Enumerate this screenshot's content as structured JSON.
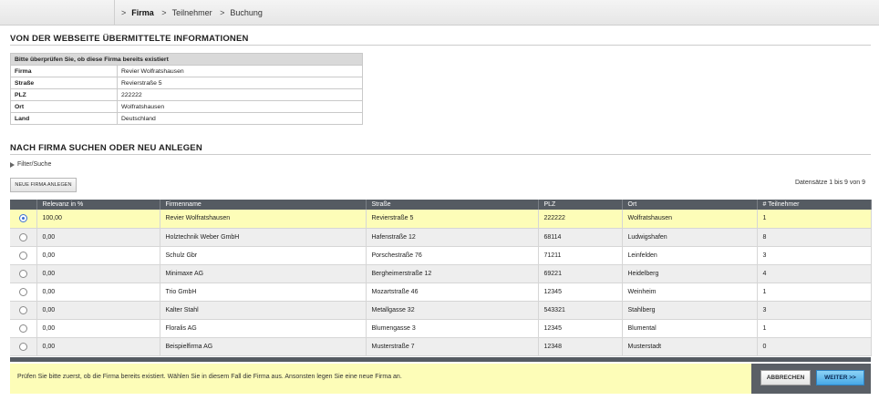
{
  "breadcrumb": {
    "items": [
      {
        "sep": ">",
        "label": "Firma"
      },
      {
        "sep": ">",
        "label": "Teilnehmer"
      },
      {
        "sep": ">",
        "label": "Buchung"
      }
    ]
  },
  "section1": {
    "title": "VON DER WEBSEITE ÜBERMITTELTE INFORMATIONEN",
    "table_header": "Bitte überprüfen Sie, ob diese Firma bereits existiert",
    "rows": [
      {
        "label": "Firma",
        "value": "Revier Wolfratshausen"
      },
      {
        "label": "Straße",
        "value": "Revierstraße 5"
      },
      {
        "label": "PLZ",
        "value": "222222"
      },
      {
        "label": "Ort",
        "value": "Wolfratshausen"
      },
      {
        "label": "Land",
        "value": "Deutschland"
      }
    ]
  },
  "section2": {
    "title": "NACH FIRMA SUCHEN ODER NEU ANLEGEN",
    "filter_label": "Filter/Suche",
    "new_button": "NEUE FIRMA ANLEGEN",
    "records_info": "Datensätze 1 bis 9 von 9"
  },
  "grid": {
    "columns": [
      "",
      "Relevanz in %",
      "Firmenname",
      "Straße",
      "PLZ",
      "Ort",
      "# Teilnehmer"
    ],
    "rows": [
      {
        "selected": true,
        "relevance": "100,00",
        "name": "Revier Wolfratshausen",
        "street": "Revierstraße 5",
        "plz": "222222",
        "city": "Wolfratshausen",
        "participants": "1"
      },
      {
        "selected": false,
        "relevance": "0,00",
        "name": "Holztechnik Weber GmbH",
        "street": "Hafenstraße 12",
        "plz": "68114",
        "city": "Ludwigshafen",
        "participants": "8"
      },
      {
        "selected": false,
        "relevance": "0,00",
        "name": "Schulz Gbr",
        "street": "Porschestraße 76",
        "plz": "71211",
        "city": "Leinfelden",
        "participants": "3"
      },
      {
        "selected": false,
        "relevance": "0,00",
        "name": "Minimaxe AG",
        "street": "Bergheimerstraße 12",
        "plz": "69221",
        "city": "Heidelberg",
        "participants": "4"
      },
      {
        "selected": false,
        "relevance": "0,00",
        "name": "Trio GmbH",
        "street": "Mozartstraße 46",
        "plz": "12345",
        "city": "Weinheim",
        "participants": "1"
      },
      {
        "selected": false,
        "relevance": "0,00",
        "name": "Kalter Stahl",
        "street": "Metallgasse 32",
        "plz": "543321",
        "city": "Stahlberg",
        "participants": "3"
      },
      {
        "selected": false,
        "relevance": "0,00",
        "name": "Floralis AG",
        "street": "Blumengasse 3",
        "plz": "12345",
        "city": "Blumental",
        "participants": "1"
      },
      {
        "selected": false,
        "relevance": "0,00",
        "name": "Beispielfirma AG",
        "street": "Musterstraße 7",
        "plz": "12348",
        "city": "Musterstadt",
        "participants": "0"
      }
    ]
  },
  "footer": {
    "message": "Prüfen Sie bitte zuerst, ob die Firma bereits existiert. Wählen Sie in diesem Fall die Firma aus. Ansonsten legen Sie eine neue Firma an.",
    "cancel_label": "ABBRECHEN",
    "next_label": "WEITER >>"
  },
  "colors": {
    "header_dark": "#555b62",
    "selected_row": "#fdfdb8",
    "accent_blue": "#47a8e5"
  }
}
